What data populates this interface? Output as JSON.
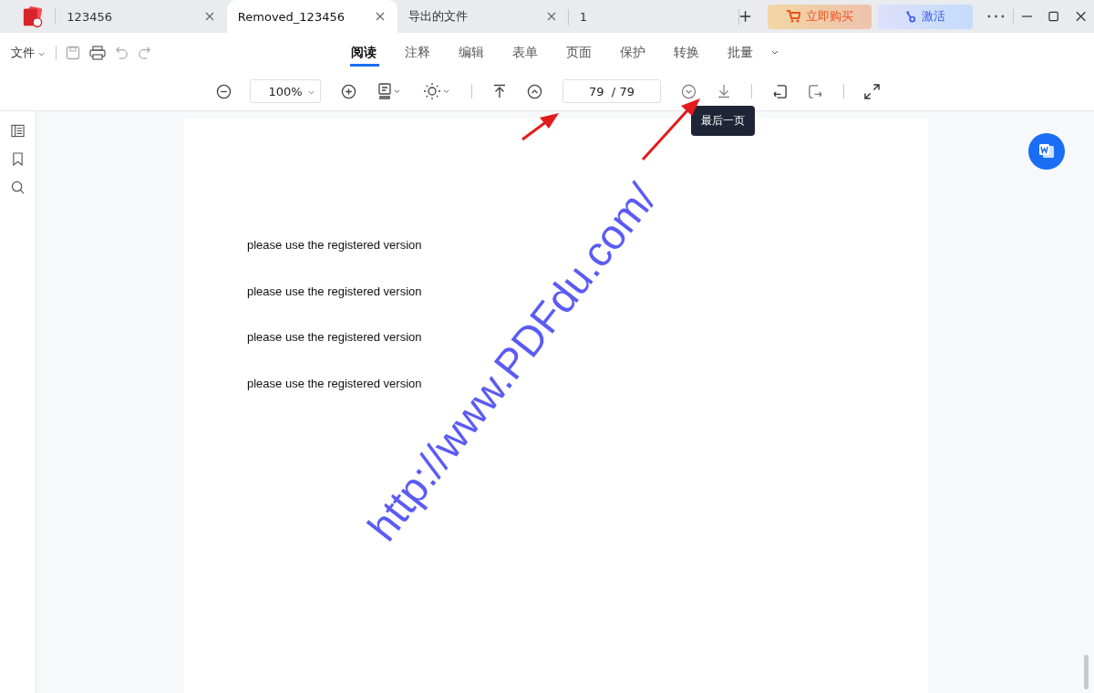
{
  "tabs": [
    {
      "label": "123456",
      "selected": false,
      "closable": true
    },
    {
      "label": "Removed_123456",
      "selected": true,
      "closable": true
    },
    {
      "label": "导出的文件",
      "selected": false,
      "closable": true
    },
    {
      "label": "1",
      "selected": false,
      "closable": false
    }
  ],
  "buy_button": "立即购买",
  "activate_button": "激活",
  "file_menu": "文件",
  "ribbon_tabs": [
    {
      "label": "阅读",
      "selected": true
    },
    {
      "label": "注释",
      "selected": false
    },
    {
      "label": "编辑",
      "selected": false
    },
    {
      "label": "表单",
      "selected": false
    },
    {
      "label": "页面",
      "selected": false
    },
    {
      "label": "保护",
      "selected": false
    },
    {
      "label": "转换",
      "selected": false
    },
    {
      "label": "批量",
      "selected": false
    }
  ],
  "zoom": {
    "value": "100%"
  },
  "page_field": {
    "current": "79",
    "separator": "/",
    "total": "79"
  },
  "tooltip": "最后一页",
  "document": {
    "lines": [
      "please use the registered version",
      "please use the registered version",
      "please use the registered version",
      "please use the registered version"
    ],
    "watermark": "http://www.PDFdu.com/"
  }
}
